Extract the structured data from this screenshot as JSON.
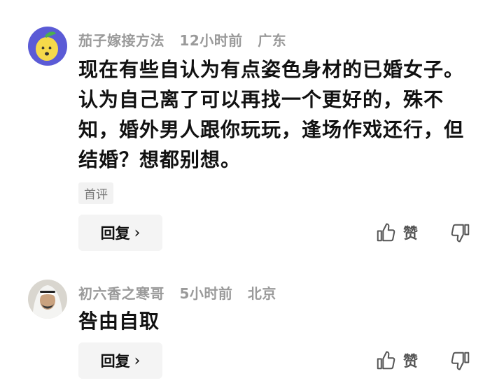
{
  "comments": [
    {
      "author": "茄子嫁接方法",
      "time": "12小时前",
      "location": "广东",
      "text": "现在有些自认为有点姿色身材的已婚女子。认为自己离了可以再找一个更好的，殊不知，婚外男人跟你玩玩，逢场作戏还行，但结婚？想都别想。",
      "tag": "首评",
      "reply_label": "回复",
      "like_label": "赞"
    },
    {
      "author": "初六香之寒哥",
      "time": "5小时前",
      "location": "北京",
      "text": "咎由自取",
      "reply_label": "回复",
      "like_label": "赞"
    }
  ],
  "icons": {
    "chevron": "chevron-right-icon",
    "like": "thumbs-up-icon",
    "dislike": "thumbs-down-icon"
  },
  "colors": {
    "meta_text": "#9a9a9a",
    "body_text": "#111111",
    "button_bg": "#f4f4f4",
    "avatar1_bg": "#5b5bd6",
    "avatar1_fruit": "#f5d94a"
  }
}
